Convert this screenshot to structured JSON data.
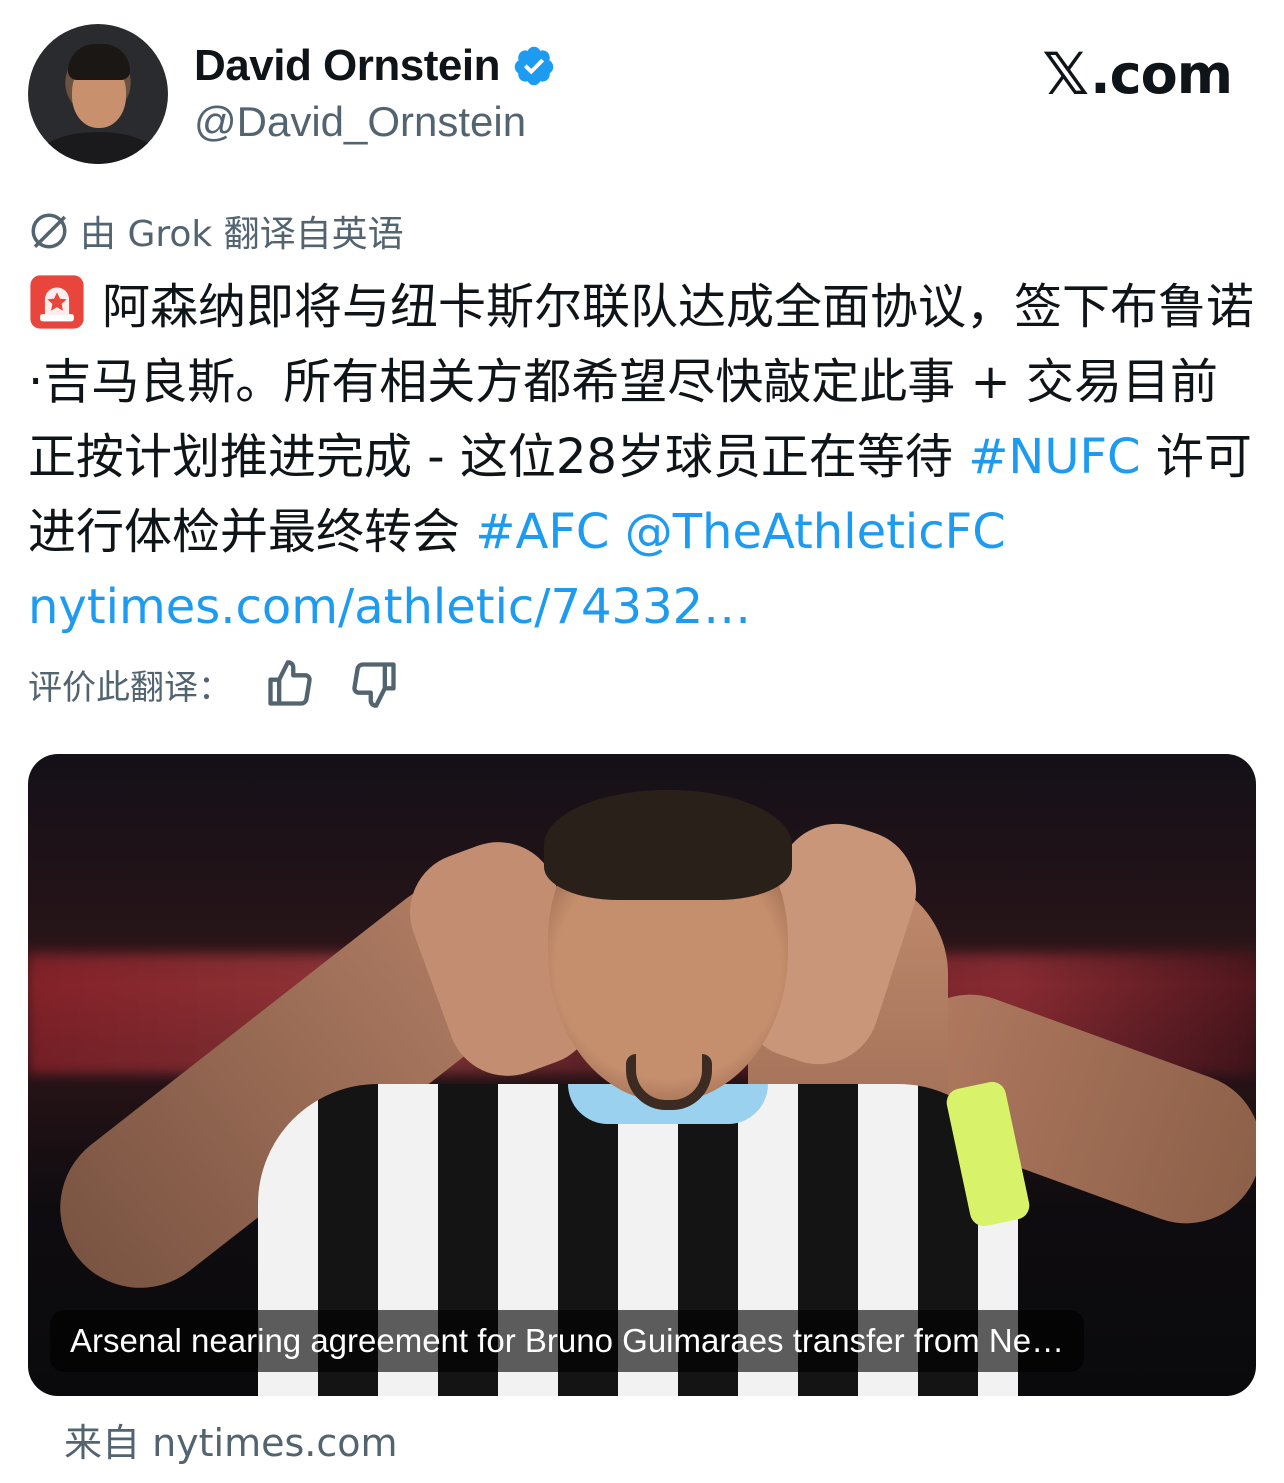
{
  "author": {
    "display_name": "David Ornstein",
    "handle": "@David_Ornstein",
    "verified_icon": "verified-badge-icon",
    "verified_color": "#1d9bf0"
  },
  "site_brand": {
    "mark": "𝕏",
    "text": ".com"
  },
  "translation_notice": {
    "icon": "globe-off-icon",
    "text": "由 Grok 翻译自英语"
  },
  "tweet": {
    "emoji": "siren-icon",
    "line_parts": [
      {
        "text": "阿森纳即将与纽卡斯尔联队达成全面协议，签下布鲁诺·吉马良斯。所有相关方都希望尽快敲定此事 + 交易目前正按计划推进完成 - 这位28岁球员正在等待 ",
        "link": false
      },
      {
        "text": "#NUFC",
        "link": true
      },
      {
        "text": " 许可进行体检并最终转会 ",
        "link": false
      },
      {
        "text": "#AFC",
        "link": true
      },
      {
        "text": " ",
        "link": false
      },
      {
        "text": "@TheAthleticFC",
        "link": true
      },
      {
        "text": " ",
        "link": false
      },
      {
        "text": "nytimes.com/athletic/74332…",
        "link": true
      }
    ],
    "link_color": "#1d9bf0"
  },
  "rating": {
    "label": "评价此翻译：",
    "thumbs_up_icon": "thumbs-up-icon",
    "thumbs_down_icon": "thumbs-down-icon"
  },
  "media_card": {
    "caption": "Arsenal nearing agreement for Bruno Guimaraes transfer from Ne…"
  },
  "source": {
    "text": "来自 nytimes.com"
  }
}
